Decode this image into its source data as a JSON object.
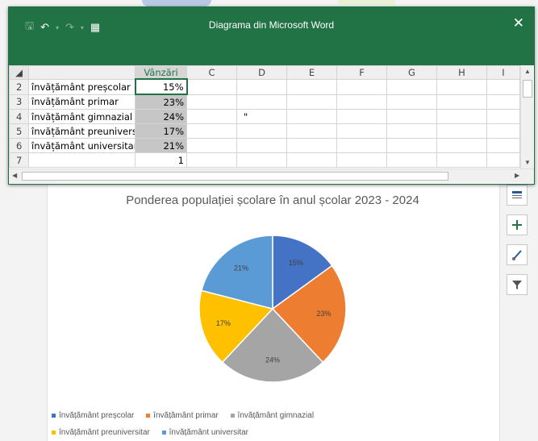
{
  "window": {
    "title": "Diagrama din Microsoft Word",
    "close_glyph": "✕"
  },
  "sheet": {
    "columns": [
      "",
      "Vânzări",
      "C",
      "D",
      "E",
      "F",
      "G",
      "H",
      "I"
    ],
    "rows": [
      {
        "n": "2",
        "label": "învățământ preșcolar",
        "value": "15%"
      },
      {
        "n": "3",
        "label": "învățământ primar",
        "value": "23%"
      },
      {
        "n": "4",
        "label": "învățământ gimnazial",
        "value": "24%"
      },
      {
        "n": "5",
        "label": "învățământ preuniversitar",
        "value": "17%"
      },
      {
        "n": "6",
        "label": "învățământ universitar",
        "value": "21%"
      },
      {
        "n": "7",
        "label": "",
        "value": "1"
      }
    ],
    "stray_mark": "\""
  },
  "chart_data": {
    "type": "pie",
    "title": "Ponderea populației școlare în anul școlar 2023 - 2024",
    "categories": [
      "învățământ preșcolar",
      "învățământ primar",
      "învățământ gimnazial",
      "învățământ preuniversitar",
      "învățământ universitar"
    ],
    "values": [
      15,
      23,
      24,
      17,
      21
    ],
    "labels": [
      "15%",
      "23%",
      "24%",
      "17%",
      "21%"
    ],
    "colors": [
      "#4472c4",
      "#ed7d31",
      "#a5a5a5",
      "#ffc000",
      "#5b9bd5"
    ],
    "legend_position": "bottom"
  },
  "side_tools": [
    "layout-options-icon",
    "chart-elements-icon",
    "chart-styles-icon",
    "chart-filters-icon"
  ]
}
